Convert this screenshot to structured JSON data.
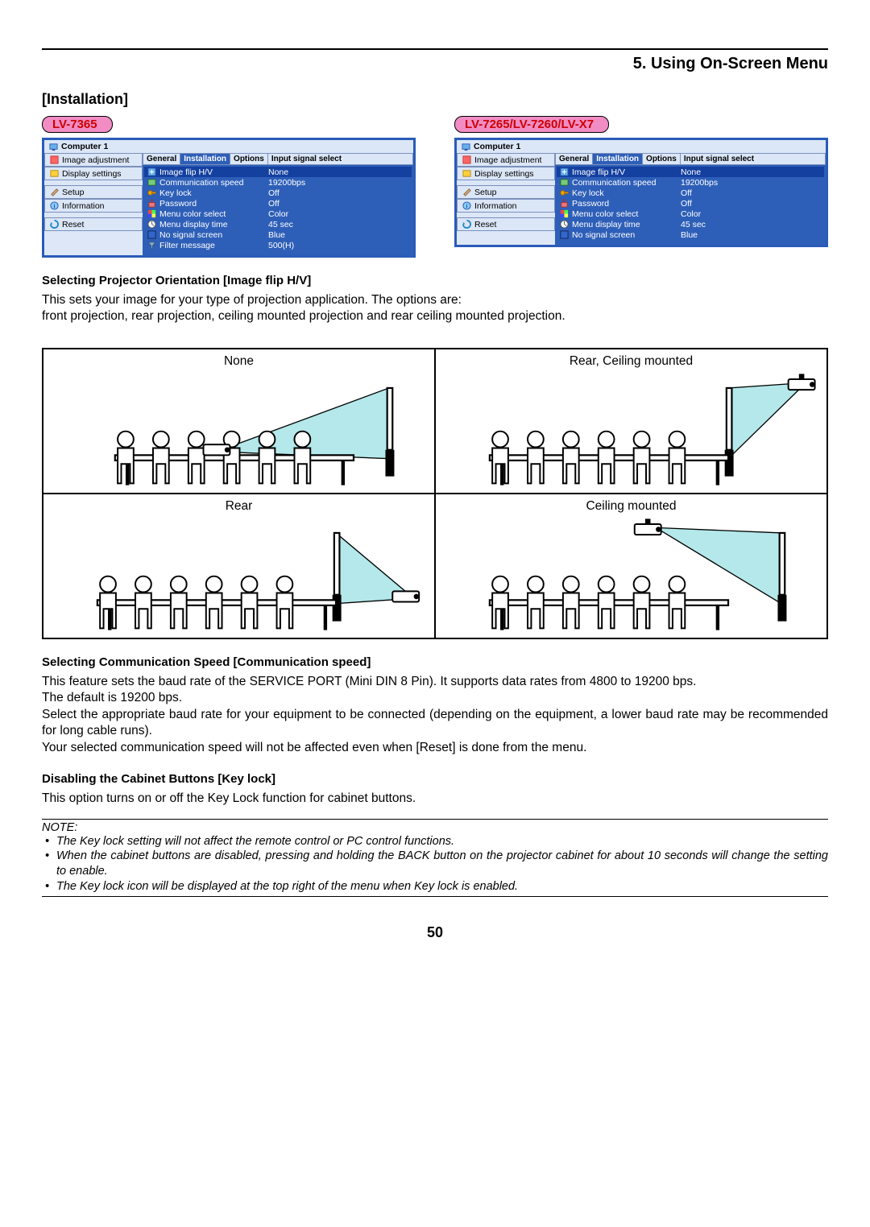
{
  "chapter": {
    "number": "5.",
    "title": "Using On-Screen Menu"
  },
  "section_heading": "[Installation]",
  "models": {
    "left": {
      "label": "LV-7365"
    },
    "right": {
      "label": "LV-7265/LV-7260/LV-X7"
    }
  },
  "osd": {
    "window_title": "Computer 1",
    "sidebar": [
      {
        "label": "Image adjustment",
        "icon": "image-icon"
      },
      {
        "label": "Display settings",
        "icon": "display-icon"
      },
      {
        "label": "Setup",
        "icon": "setup-icon"
      },
      {
        "label": "Information",
        "icon": "info-icon"
      },
      {
        "label": "Reset",
        "icon": "reset-icon"
      }
    ],
    "tabs": [
      "General",
      "Installation",
      "Options",
      "Input signal select"
    ],
    "active_tab_index": 1,
    "rows_left": [
      {
        "label": "Image flip H/V",
        "value": "None",
        "icon": "flip-icon",
        "highlight": true
      },
      {
        "label": "Communication speed",
        "value": "19200bps",
        "icon": "comm-icon"
      },
      {
        "label": "Key lock",
        "value": "Off",
        "icon": "keylock-icon"
      },
      {
        "label": "Password",
        "value": "Off",
        "icon": "password-icon"
      },
      {
        "label": "Menu color select",
        "value": "Color",
        "icon": "colorsel-icon"
      },
      {
        "label": "Menu display time",
        "value": "45 sec",
        "icon": "time-icon"
      },
      {
        "label": "No signal screen",
        "value": "Blue",
        "icon": "nosignal-icon"
      },
      {
        "label": "Filter message",
        "value": "500(H)",
        "icon": "filter-icon"
      }
    ],
    "rows_right": [
      {
        "label": "Image flip H/V",
        "value": "None",
        "icon": "flip-icon",
        "highlight": true
      },
      {
        "label": "Communication speed",
        "value": "19200bps",
        "icon": "comm-icon"
      },
      {
        "label": "Key lock",
        "value": "Off",
        "icon": "keylock-icon"
      },
      {
        "label": "Password",
        "value": "Off",
        "icon": "password-icon"
      },
      {
        "label": "Menu color select",
        "value": "Color",
        "icon": "colorsel-icon"
      },
      {
        "label": "Menu display time",
        "value": "45 sec",
        "icon": "time-icon"
      },
      {
        "label": "No signal screen",
        "value": "Blue",
        "icon": "nosignal-icon"
      }
    ]
  },
  "sub_orientation": {
    "heading": "Selecting Projector Orientation [Image flip H/V]",
    "p1": "This sets your image for your type of projection application. The options are:",
    "p2": "front projection, rear projection, ceiling mounted projection and rear ceiling mounted projection."
  },
  "orientation": {
    "tl": "None",
    "tr": "Rear, Ceiling mounted",
    "bl": "Rear",
    "br": "Ceiling mounted"
  },
  "sub_comm": {
    "heading": "Selecting Communication Speed [Communication speed]",
    "p1": "This feature sets the baud rate of the SERVICE PORT (Mini DIN 8 Pin). It supports data rates from 4800 to 19200 bps.",
    "p2": "The default is 19200 bps.",
    "p3": "Select the appropriate baud rate for your equipment to be connected (depending on the equipment, a lower baud rate may be recommended for long cable runs).",
    "p4": "Your selected communication speed will not be affected even when [Reset] is done from the menu."
  },
  "sub_keylock": {
    "heading": "Disabling the Cabinet Buttons [Key lock]",
    "p1": "This option turns on or off the Key Lock function for cabinet buttons."
  },
  "note": {
    "label": "NOTE:",
    "items": [
      "The Key lock setting will not affect the remote control or PC control functions.",
      "When the cabinet buttons are disabled, pressing and holding the BACK button on the projector cabinet for about 10 seconds will change the setting to enable.",
      "The Key lock icon will be displayed at the top right of the menu when Key lock is enabled."
    ]
  },
  "page_number": "50"
}
